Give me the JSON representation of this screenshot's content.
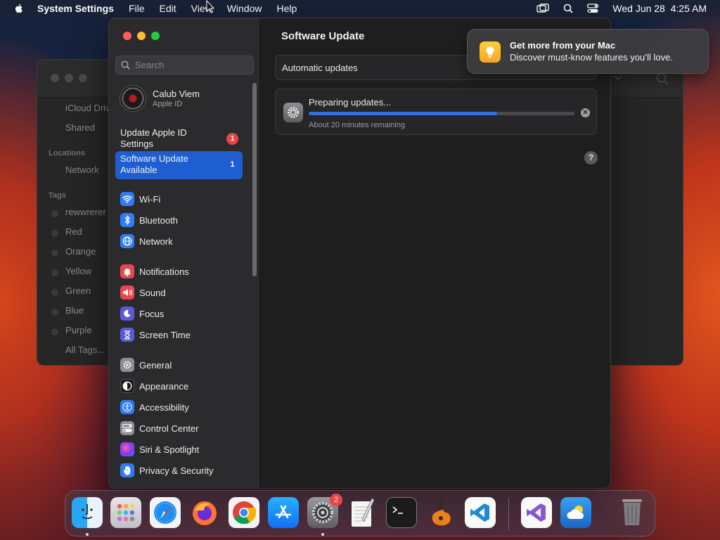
{
  "menubar": {
    "app_name": "System Settings",
    "menus": [
      "File",
      "Edit",
      "View",
      "Window",
      "Help"
    ],
    "datetime": "Wed Jun 28  4:25 AM"
  },
  "finder": {
    "favorites": [
      "iCloud Drive",
      "Shared"
    ],
    "locations_header": "Locations",
    "locations": [
      "Network"
    ],
    "tags_header": "Tags",
    "tags": [
      {
        "label": "rewwrerer",
        "color": "#3a3a3a"
      },
      {
        "label": "Red",
        "color": "#3a3a3a"
      },
      {
        "label": "Orange",
        "color": "#3a3a3a"
      },
      {
        "label": "Yellow",
        "color": "#3a3a3a"
      },
      {
        "label": "Green",
        "color": "#3a3a3a"
      },
      {
        "label": "Blue",
        "color": "#3a3a3a"
      },
      {
        "label": "Purple",
        "color": "#3a3a3a"
      },
      {
        "label": "All Tags...",
        "color": ""
      }
    ]
  },
  "settings": {
    "search_placeholder": "Search",
    "account": {
      "name": "Calub Viem",
      "subtitle": "Apple ID"
    },
    "update_apple_id": {
      "label": "Update Apple ID Settings",
      "badge": "1"
    },
    "software_update_available": {
      "label": "Software Update Available",
      "badge": "1"
    },
    "nav": [
      {
        "label": "Wi-Fi",
        "icon": "wifi-icon",
        "color": "#2f7df6"
      },
      {
        "label": "Bluetooth",
        "icon": "bluetooth-icon",
        "color": "#2f7df6"
      },
      {
        "label": "Network",
        "icon": "globe-icon",
        "color": "#2f7df6"
      },
      {
        "label": "Notifications",
        "icon": "bell-icon",
        "color": "#e9474d"
      },
      {
        "label": "Sound",
        "icon": "speaker-icon",
        "color": "#e9474d"
      },
      {
        "label": "Focus",
        "icon": "moon-icon",
        "color": "#5b5bd6"
      },
      {
        "label": "Screen Time",
        "icon": "hourglass-icon",
        "color": "#5b5bd6"
      },
      {
        "label": "General",
        "icon": "gear-icon",
        "color": "#8e8e93"
      },
      {
        "label": "Appearance",
        "icon": "appearance-icon",
        "color": "#1c1c1e"
      },
      {
        "label": "Accessibility",
        "icon": "accessibility-icon",
        "color": "#2f7df6"
      },
      {
        "label": "Control Center",
        "icon": "control-center-icon",
        "color": "#8e8e93"
      },
      {
        "label": "Siri & Spotlight",
        "icon": "siri-icon",
        "color": "#b44bd8"
      },
      {
        "label": "Privacy & Security",
        "icon": "hand-icon",
        "color": "#2f7df6"
      }
    ],
    "main": {
      "title": "Software Update",
      "automatic_updates": "Automatic updates",
      "progress_title": "Preparing updates...",
      "progress_fraction": 0.71,
      "progress_remaining": "About 20 minutes remaining",
      "help": "?"
    }
  },
  "notification": {
    "title": "Get more from your Mac",
    "body": "Discover must-know features you’ll love."
  },
  "dock": {
    "apps": [
      {
        "name": "Finder",
        "icon": "finder-icon",
        "color": "#1e8ff0",
        "running": true
      },
      {
        "name": "Launchpad",
        "icon": "launchpad-icon",
        "color": "#d9d9de",
        "running": false
      },
      {
        "name": "Safari",
        "icon": "safari-icon",
        "color": "#ffffff",
        "running": false
      },
      {
        "name": "Firefox",
        "icon": "firefox-icon",
        "color": "#ff7139",
        "running": false
      },
      {
        "name": "Chrome",
        "icon": "chrome-icon",
        "color": "#ffffff",
        "running": false
      },
      {
        "name": "App Store",
        "icon": "app-store-icon",
        "color": "#1a8cf5",
        "running": false
      },
      {
        "name": "System Settings",
        "icon": "system-settings-icon",
        "color": "#8e8e93",
        "running": true,
        "badge": "2"
      },
      {
        "name": "TextEdit",
        "icon": "textedit-icon",
        "color": "#f2f2f2",
        "running": false
      },
      {
        "name": "Terminal",
        "icon": "terminal-icon",
        "color": "#1c1c1c",
        "running": false
      },
      {
        "name": "GarageBand",
        "icon": "garageband-icon",
        "color": "#f28a1c",
        "running": false
      },
      {
        "name": "Visual Studio Code",
        "icon": "vscode-icon",
        "color": "#ffffff",
        "running": false
      },
      {
        "name": "Visual Studio",
        "icon": "visual-studio-icon",
        "color": "#ffffff",
        "running": false
      },
      {
        "name": "Weather",
        "icon": "weather-icon",
        "color": "#2a83e0",
        "running": false
      },
      {
        "name": "Trash",
        "icon": "trash-icon",
        "color": "#8a8a8f",
        "running": false
      }
    ]
  }
}
